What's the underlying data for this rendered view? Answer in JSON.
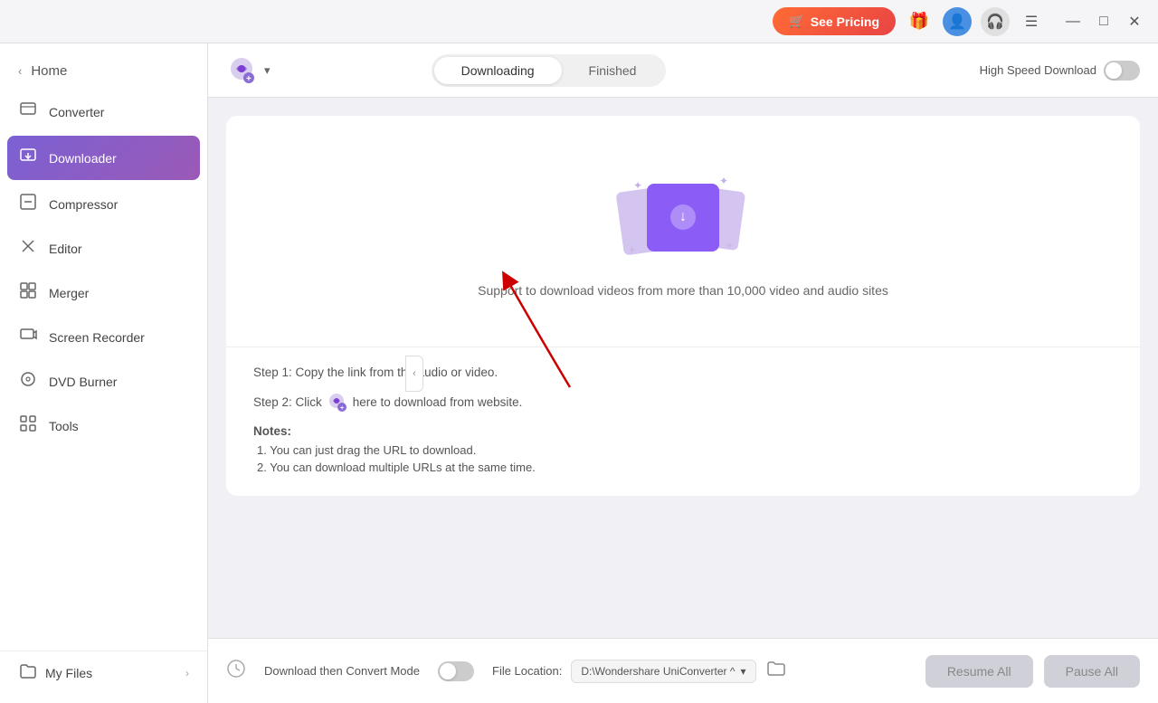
{
  "titlebar": {
    "see_pricing_label": "See Pricing",
    "cart_icon": "🛒",
    "user_icon": "👤",
    "headset_icon": "🎧",
    "menu_icon": "☰",
    "minimize_icon": "—",
    "maximize_icon": "□",
    "close_icon": "✕"
  },
  "sidebar": {
    "home_label": "Home",
    "nav_items": [
      {
        "id": "converter",
        "label": "Converter",
        "icon": "🖥"
      },
      {
        "id": "downloader",
        "label": "Downloader",
        "icon": "⬇",
        "active": true
      },
      {
        "id": "compressor",
        "label": "Compressor",
        "icon": "🗜"
      },
      {
        "id": "editor",
        "label": "Editor",
        "icon": "✂"
      },
      {
        "id": "merger",
        "label": "Merger",
        "icon": "⊞"
      },
      {
        "id": "screen-recorder",
        "label": "Screen Recorder",
        "icon": "🎬"
      },
      {
        "id": "dvd-burner",
        "label": "DVD Burner",
        "icon": "💿"
      },
      {
        "id": "tools",
        "label": "Tools",
        "icon": "⚙"
      }
    ],
    "my_files_label": "My Files"
  },
  "toolbar": {
    "tab_downloading": "Downloading",
    "tab_finished": "Finished",
    "high_speed_label": "High Speed Download",
    "toggle_state": "off"
  },
  "content": {
    "support_text": "Support to download videos from more than 10,000 video and audio sites",
    "step1": "Step 1: Copy the link from the audio or video.",
    "step2_prefix": "Step 2: Click",
    "step2_suffix": "here to download from website.",
    "notes_title": "Notes:",
    "note1": "1. You can just drag the URL to download.",
    "note2": "2. You can download multiple URLs at the same time."
  },
  "bottom": {
    "convert_mode_label": "Download then Convert Mode",
    "file_location_label": "File Location:",
    "file_path": "D:\\Wondershare UniConverter ^",
    "resume_label": "Resume All",
    "pause_label": "Pause All"
  }
}
